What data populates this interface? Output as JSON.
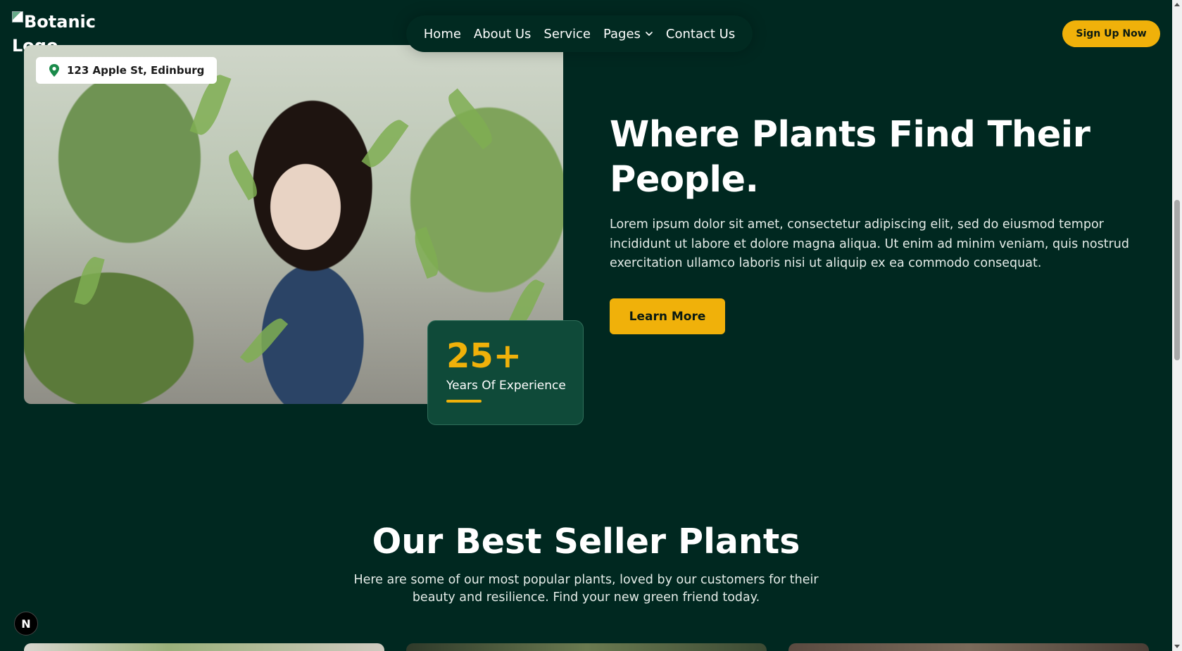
{
  "header": {
    "logo_alt": "Botanic Logo",
    "nav": [
      {
        "label": "Home"
      },
      {
        "label": "About Us"
      },
      {
        "label": "Service"
      },
      {
        "label": "Pages",
        "has_dropdown": true
      },
      {
        "label": "Contact Us"
      }
    ],
    "signup_label": "Sign Up Now"
  },
  "hero": {
    "address": "123 Apple St, Edinburg",
    "experience_number": "25+",
    "experience_label": "Years Of Experience",
    "title": "Where Plants Find Their People.",
    "description": "Lorem ipsum dolor sit amet, consectetur adipiscing elit, sed do eiusmod tempor incididunt ut labore et dolore magna aliqua. Ut enim ad minim veniam, quis nostrud exercitation ullamco laboris nisi ut aliquip ex ea commodo consequat.",
    "cta_label": "Learn More"
  },
  "best_seller": {
    "title": "Our Best Seller Plants",
    "description": "Here are some of our most popular plants, loved by our customers for their beauty and resilience. Find your new green friend today."
  },
  "dev_badge": "N",
  "colors": {
    "background": "#002820",
    "accent": "#f0b10a",
    "card": "#0f4a39"
  },
  "icons": {
    "location": "map-pin-icon",
    "dropdown": "chevron-down-icon"
  }
}
